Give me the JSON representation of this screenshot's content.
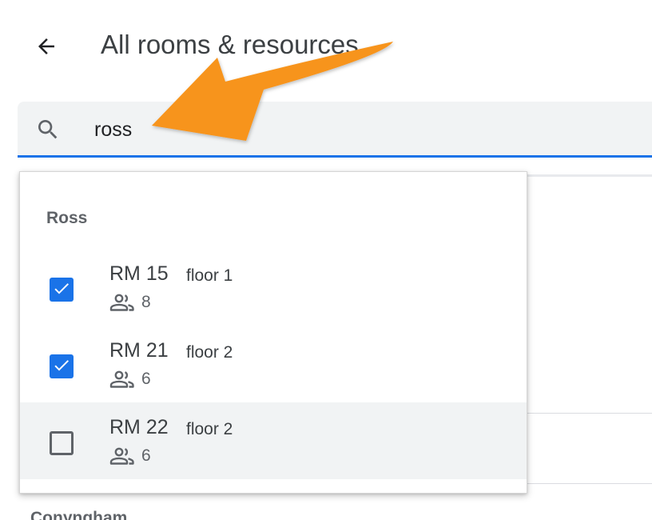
{
  "header": {
    "title": "All rooms & resources",
    "back_icon": "arrow-back-icon"
  },
  "search": {
    "value": "ross",
    "icon": "search-icon"
  },
  "dropdown": {
    "group": "Ross",
    "rooms": [
      {
        "name": "RM 15",
        "floor": "floor 1",
        "capacity": "8",
        "checked": true
      },
      {
        "name": "RM 21",
        "floor": "floor 2",
        "capacity": "6",
        "checked": true
      },
      {
        "name": "RM 22",
        "floor": "floor 2",
        "capacity": "6",
        "checked": false
      }
    ]
  },
  "background_list": {
    "section": "Conyngham"
  },
  "colors": {
    "accent": "#1a73e8",
    "annotation_arrow": "#f7941d",
    "hover_row": "#f1f3f4"
  }
}
